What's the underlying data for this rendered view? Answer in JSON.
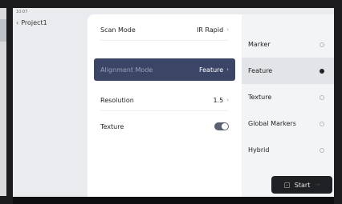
{
  "status": {
    "time": "10:07"
  },
  "nav": {
    "back_label": "Project1"
  },
  "settings": {
    "rows": [
      {
        "label": "Scan Mode",
        "value": "IR Rapid"
      },
      {
        "label": "Alignment Mode",
        "value": "Feature"
      },
      {
        "label": "Resolution",
        "value": "1.5"
      },
      {
        "label": "Texture",
        "value": ""
      }
    ],
    "texture_on": true
  },
  "alignment_options": [
    {
      "label": "Marker",
      "selected": false
    },
    {
      "label": "Feature",
      "selected": true
    },
    {
      "label": "Texture",
      "selected": false
    },
    {
      "label": "Global Markers",
      "selected": false
    },
    {
      "label": "Hybrid",
      "selected": false
    }
  ],
  "start_button": {
    "label": "Start"
  },
  "icons": {
    "back": "chevron-left-icon",
    "row_arrow": "chevron-right-icon",
    "scan": "scan-icon",
    "start_arrow": "arrow-icon"
  },
  "colors": {
    "selected_row": "#3b4566",
    "start_button": "#1f2125"
  }
}
